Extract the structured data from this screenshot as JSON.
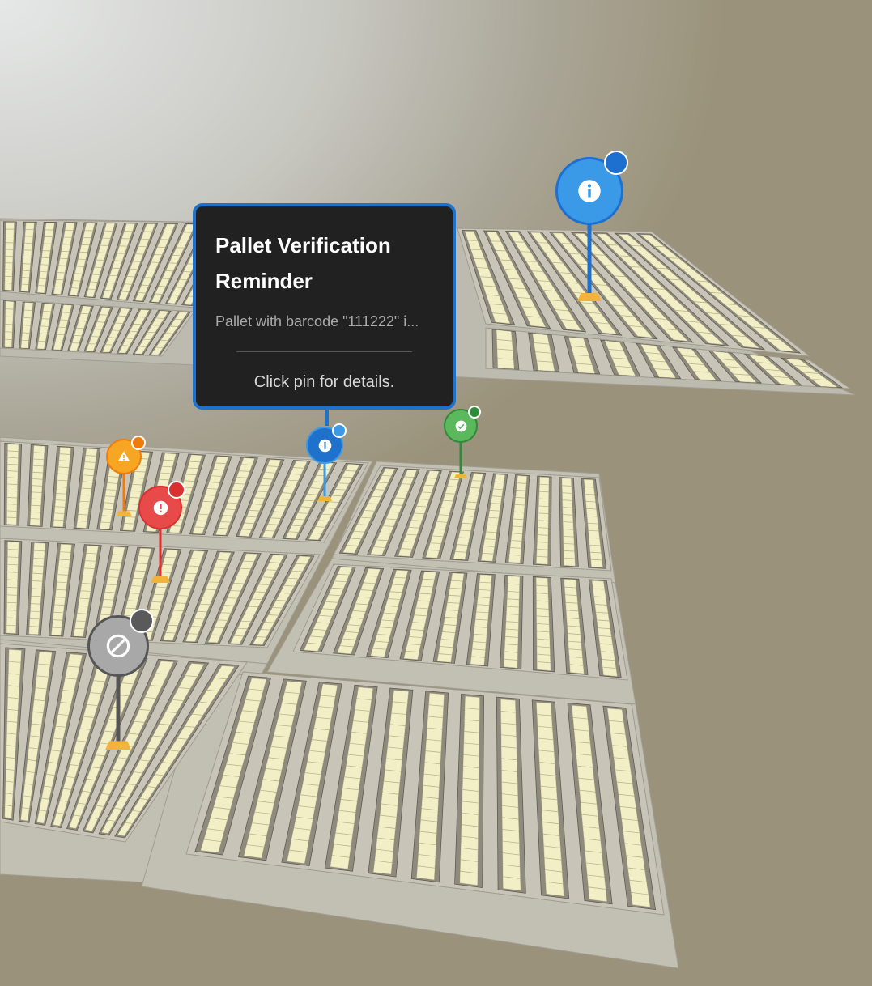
{
  "tooltip": {
    "title_line1": "Pallet Verification",
    "title_line2": "Reminder",
    "message": "Pallet with barcode \"111222\" i...",
    "hint": "Click pin for details."
  },
  "pins": [
    {
      "name": "info-pin-large",
      "status": "info",
      "color": "#3a9ae8",
      "badge_color": "#1d6fd0",
      "icon": "info-icon"
    },
    {
      "name": "info-pin-active",
      "status": "info",
      "color": "#1e72cc",
      "badge_color": "#3a9ae8",
      "icon": "info-icon"
    },
    {
      "name": "success-pin",
      "status": "success",
      "color": "#5cb85c",
      "badge_color": "#2e8b3a",
      "icon": "check-icon"
    },
    {
      "name": "warning-pin",
      "status": "warning",
      "color": "#f6a623",
      "badge_color": "#ef7b0a",
      "icon": "warning-icon"
    },
    {
      "name": "error-pin",
      "status": "error",
      "color": "#e84a4a",
      "badge_color": "#d9312f",
      "icon": "exclamation-icon"
    },
    {
      "name": "blocked-pin",
      "status": "disabled",
      "color": "#a8a8a8",
      "badge_color": "#5a5a5a",
      "icon": "block-icon"
    }
  ],
  "colors": {
    "pallet": "#f2efc6",
    "rack": "#8e8a7e",
    "floor": "#c8c5b8",
    "pin_foot": "#f2b33b"
  }
}
